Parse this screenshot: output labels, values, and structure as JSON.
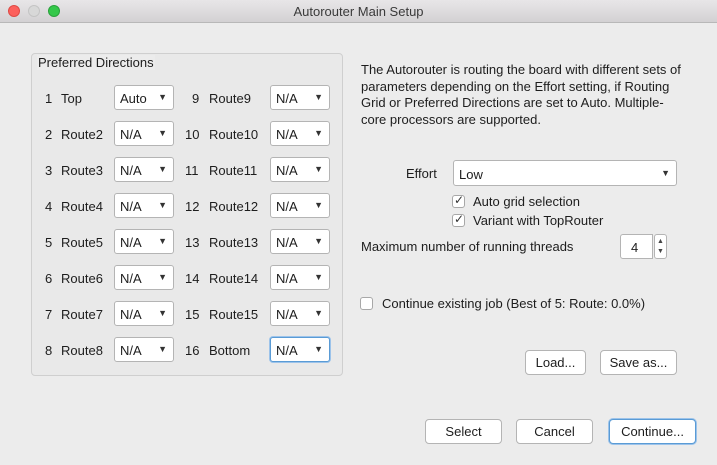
{
  "window": {
    "title": "Autorouter Main Setup"
  },
  "preferred_directions": {
    "title": "Preferred Directions",
    "rows": [
      {
        "num": "1",
        "name": "Top",
        "value": "Auto"
      },
      {
        "num": "2",
        "name": "Route2",
        "value": "N/A"
      },
      {
        "num": "3",
        "name": "Route3",
        "value": "N/A"
      },
      {
        "num": "4",
        "name": "Route4",
        "value": "N/A"
      },
      {
        "num": "5",
        "name": "Route5",
        "value": "N/A"
      },
      {
        "num": "6",
        "name": "Route6",
        "value": "N/A"
      },
      {
        "num": "7",
        "name": "Route7",
        "value": "N/A"
      },
      {
        "num": "8",
        "name": "Route8",
        "value": "N/A"
      },
      {
        "num": "9",
        "name": "Route9",
        "value": "N/A"
      },
      {
        "num": "10",
        "name": "Route10",
        "value": "N/A"
      },
      {
        "num": "11",
        "name": "Route11",
        "value": "N/A"
      },
      {
        "num": "12",
        "name": "Route12",
        "value": "N/A"
      },
      {
        "num": "13",
        "name": "Route13",
        "value": "N/A"
      },
      {
        "num": "14",
        "name": "Route14",
        "value": "N/A"
      },
      {
        "num": "15",
        "name": "Route15",
        "value": "N/A"
      },
      {
        "num": "16",
        "name": "Bottom",
        "value": "N/A"
      }
    ]
  },
  "description": "The Autorouter is routing the board with different sets of parameters depending on the Effort setting, if Routing Grid or Preferred Directions are set to Auto. Multiple-core processors are supported.",
  "effort": {
    "label": "Effort",
    "value": "Low"
  },
  "auto_grid": {
    "label": "Auto grid selection",
    "checked": true
  },
  "variant_toprouter": {
    "label": "Variant with TopRouter",
    "checked": true
  },
  "threads": {
    "label": "Maximum number of running threads",
    "value": "4"
  },
  "continue_job": {
    "label": "Continue existing job (Best of 5: Route: 0.0%)",
    "checked": false
  },
  "buttons": {
    "load": "Load...",
    "save_as": "Save as...",
    "select": "Select",
    "cancel": "Cancel",
    "continue": "Continue..."
  },
  "icons": {
    "check": "checkmark-icon",
    "caret": "chevron-down-icon",
    "spin_up": "arrow-up-icon",
    "spin_down": "arrow-down-icon"
  }
}
